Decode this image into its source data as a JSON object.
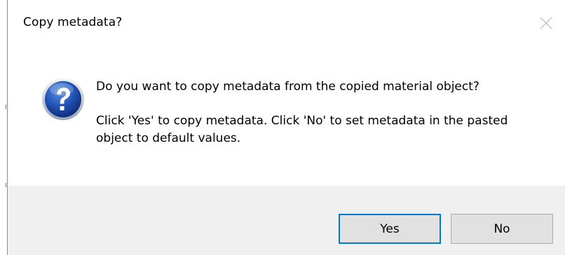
{
  "dialog": {
    "title": "Copy metadata?",
    "icon": "question-icon",
    "close_icon": "close-icon",
    "message_line1": "Do you want to copy metadata from the copied material object?",
    "message_line2": "Click 'Yes' to copy metadata. Click 'No' to set metadata in the pasted object to default values.",
    "buttons": {
      "yes_label": "Yes",
      "no_label": "No"
    }
  },
  "colors": {
    "accent": "#0078d7",
    "footer_bg": "#f0f0f0",
    "button_bg": "#e1e1e1",
    "icon_blue": "#1f4fa8"
  }
}
